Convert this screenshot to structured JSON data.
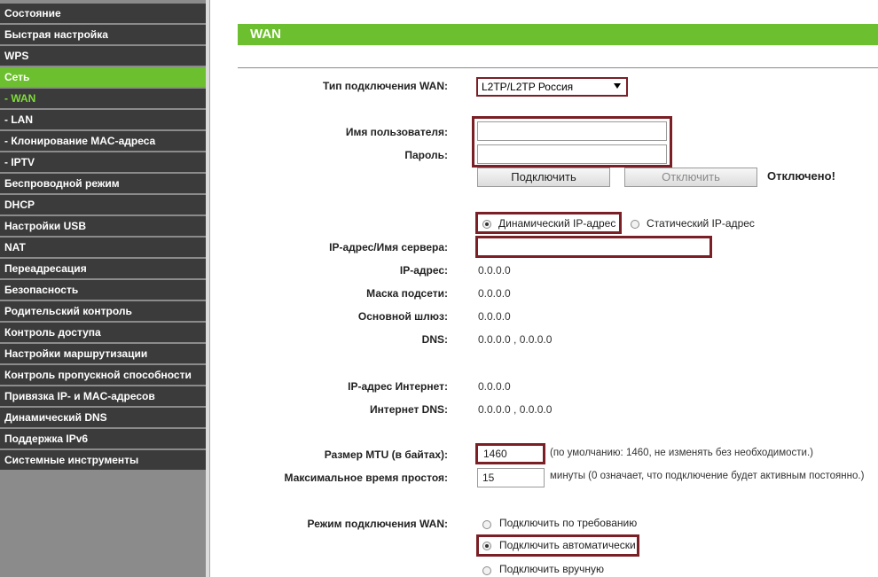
{
  "sidebar": {
    "items": [
      {
        "label": "Состояние"
      },
      {
        "label": "Быстрая настройка"
      },
      {
        "label": "WPS"
      },
      {
        "label": "Сеть"
      },
      {
        "label": "- WAN"
      },
      {
        "label": "- LAN"
      },
      {
        "label": "- Клонирование MAC-адреса"
      },
      {
        "label": "- IPTV"
      },
      {
        "label": "Беспроводной режим"
      },
      {
        "label": "DHCP"
      },
      {
        "label": "Настройки USB"
      },
      {
        "label": "NAT"
      },
      {
        "label": "Переадресация"
      },
      {
        "label": "Безопасность"
      },
      {
        "label": "Родительский контроль"
      },
      {
        "label": "Контроль доступа"
      },
      {
        "label": "Настройки маршрутизации"
      },
      {
        "label": "Контроль пропускной способности"
      },
      {
        "label": "Привязка IP- и MAC-адресов"
      },
      {
        "label": "Динамический DNS"
      },
      {
        "label": "Поддержка IPv6"
      },
      {
        "label": "Системные инструменты"
      }
    ]
  },
  "header": {
    "title": "WAN"
  },
  "form": {
    "conn_type_label": "Тип подключения WAN:",
    "conn_type_value": "L2TP/L2TP Россия",
    "username_label": "Имя пользователя:",
    "username_value": "",
    "password_label": "Пароль:",
    "password_value": "",
    "connect_btn": "Подключить",
    "disconnect_btn": "Отключить",
    "status": "Отключено!",
    "dynamic_ip_label": "Динамический IP-адрес",
    "static_ip_label": "Статический IP-адрес",
    "server_label": "IP-адрес/Имя сервера:",
    "server_value": "",
    "ip_label": "IP-адрес:",
    "ip_value": "0.0.0.0",
    "mask_label": "Маска подсети:",
    "mask_value": "0.0.0.0",
    "gateway_label": "Основной шлюз:",
    "gateway_value": "0.0.0.0",
    "dns_label": "DNS:",
    "dns_value": "0.0.0.0 , 0.0.0.0",
    "inet_ip_label": "IP-адрес Интернет:",
    "inet_ip_value": "0.0.0.0",
    "inet_dns_label": "Интернет DNS:",
    "inet_dns_value": "0.0.0.0 , 0.0.0.0",
    "mtu_label": "Размер MTU (в байтах):",
    "mtu_value": "1460",
    "mtu_note": "(по умолчанию: 1460, не изменять без необходимости.)",
    "idle_label": "Максимальное время простоя:",
    "idle_value": "15",
    "idle_note": "минуты (0 означает, что подключение будет активным постоянно.)",
    "mode_label": "Режим подключения WAN:",
    "mode_on_demand": "Подключить по требованию",
    "mode_auto": "Подключить автоматически",
    "mode_manual": "Подключить вручную"
  },
  "colors": {
    "accent": "#6cbf2e",
    "highlight_border": "#7a1f25",
    "sidebar_bg": "#3b3b3b"
  }
}
